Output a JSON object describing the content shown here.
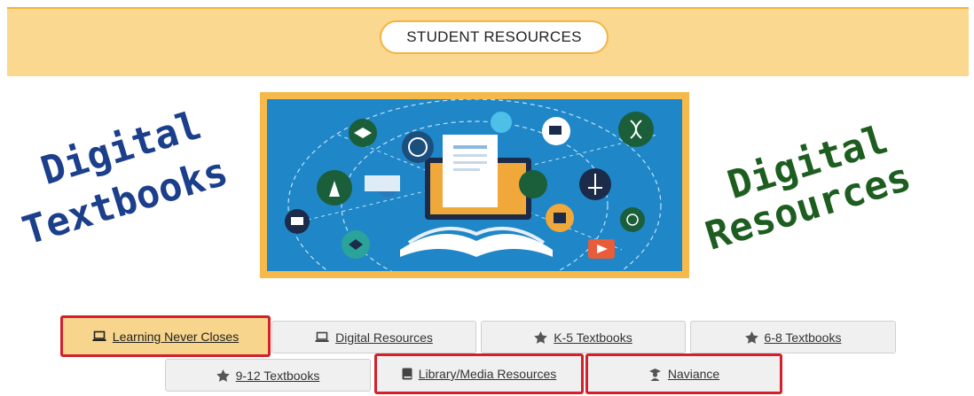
{
  "banner": {
    "title": "STUDENT RESOURCES"
  },
  "left_heading": {
    "line1": "Digital",
    "line2": "Textbooks"
  },
  "right_heading": {
    "line1": "Digital",
    "line2": "Resources"
  },
  "colors": {
    "banner": "#fbd88f",
    "accent": "#f3b443",
    "highlight": "#d3202a",
    "blue_heading": "#1c3f8c",
    "green_heading": "#1d5e20"
  },
  "buttons": [
    {
      "label": "Learning Never Closes",
      "icon": "laptop-icon",
      "active": true
    },
    {
      "label": "Digital Resources",
      "icon": "laptop-icon"
    },
    {
      "label": "K-5 Textbooks",
      "icon": "star-icon"
    },
    {
      "label": "6-8 Textbooks",
      "icon": "star-icon"
    },
    {
      "label": "9-12 Textbooks",
      "icon": "star-icon"
    },
    {
      "label": "Library/Media Resources",
      "icon": "book-icon",
      "highlighted": true
    },
    {
      "label": "Naviance",
      "icon": "graduate-icon",
      "highlighted": true
    }
  ]
}
